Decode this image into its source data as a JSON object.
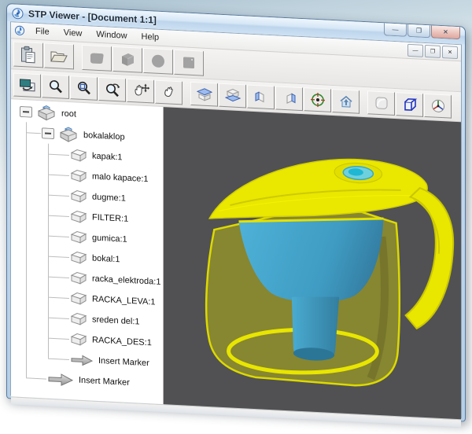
{
  "window": {
    "title": "STP Viewer - [Document 1:1]",
    "controls": {
      "minimize": "—",
      "maximize": "❐",
      "close": "✕"
    }
  },
  "mdi": {
    "controls": {
      "minimize": "—",
      "restore": "❐",
      "close": "✕"
    }
  },
  "menubar": {
    "items": [
      {
        "label": "File"
      },
      {
        "label": "View"
      },
      {
        "label": "Window"
      },
      {
        "label": "Help"
      }
    ]
  },
  "toolbars": {
    "standard": {
      "icons": [
        "paste-icon",
        "open-folder-icon",
        "solid-slab-icon",
        "solid-cube-icon",
        "solid-sphere-icon",
        "solid-panel-icon"
      ],
      "disabled_icons": [
        "solid-slab-icon",
        "solid-cube-icon",
        "solid-sphere-icon",
        "solid-panel-icon"
      ]
    },
    "view": {
      "icons": [
        "capture-view-icon",
        "zoom-icon",
        "zoom-window-icon",
        "zoom-rotate-icon",
        "pan-hand-icon",
        "rotate-hand-icon",
        "view-top-icon",
        "view-bottom-icon",
        "view-left-icon",
        "view-right-icon",
        "orbit-target-icon",
        "home-view-icon",
        "render-shaded-icon",
        "render-wireframe-icon",
        "axes-ball-icon"
      ]
    }
  },
  "tree": {
    "items": [
      {
        "label": "root",
        "level": 0,
        "icon": "assembly",
        "expanded": true
      },
      {
        "label": "bokalaklop",
        "level": 1,
        "icon": "assembly",
        "expanded": true
      },
      {
        "label": "kapak:1",
        "level": 2,
        "icon": "part"
      },
      {
        "label": "malo kapace:1",
        "level": 2,
        "icon": "part"
      },
      {
        "label": "dugme:1",
        "level": 2,
        "icon": "part"
      },
      {
        "label": "FILTER:1",
        "level": 2,
        "icon": "part"
      },
      {
        "label": "gumica:1",
        "level": 2,
        "icon": "part"
      },
      {
        "label": "bokal:1",
        "level": 2,
        "icon": "part"
      },
      {
        "label": "racka_elektroda:1",
        "level": 2,
        "icon": "part"
      },
      {
        "label": "RACKA_LEVA:1",
        "level": 2,
        "icon": "part"
      },
      {
        "label": "sreden del:1",
        "level": 2,
        "icon": "part"
      },
      {
        "label": "RACKA_DES:1",
        "level": 2,
        "icon": "part"
      },
      {
        "label": "Insert Marker",
        "level": 2,
        "icon": "marker-arrow"
      },
      {
        "label": "Insert Marker",
        "level": 1,
        "icon": "marker-arrow"
      }
    ]
  },
  "viewport": {
    "background_color": "#515153",
    "model": "water filter pitcher (translucent yellow jug, yellow lid and handle, cyan filter funnel, cyan lid button)",
    "colors": {
      "body_edge": "#e8e500",
      "lid": "#eae700",
      "insert": "#45aacd",
      "button": "#1fb7d3"
    }
  }
}
